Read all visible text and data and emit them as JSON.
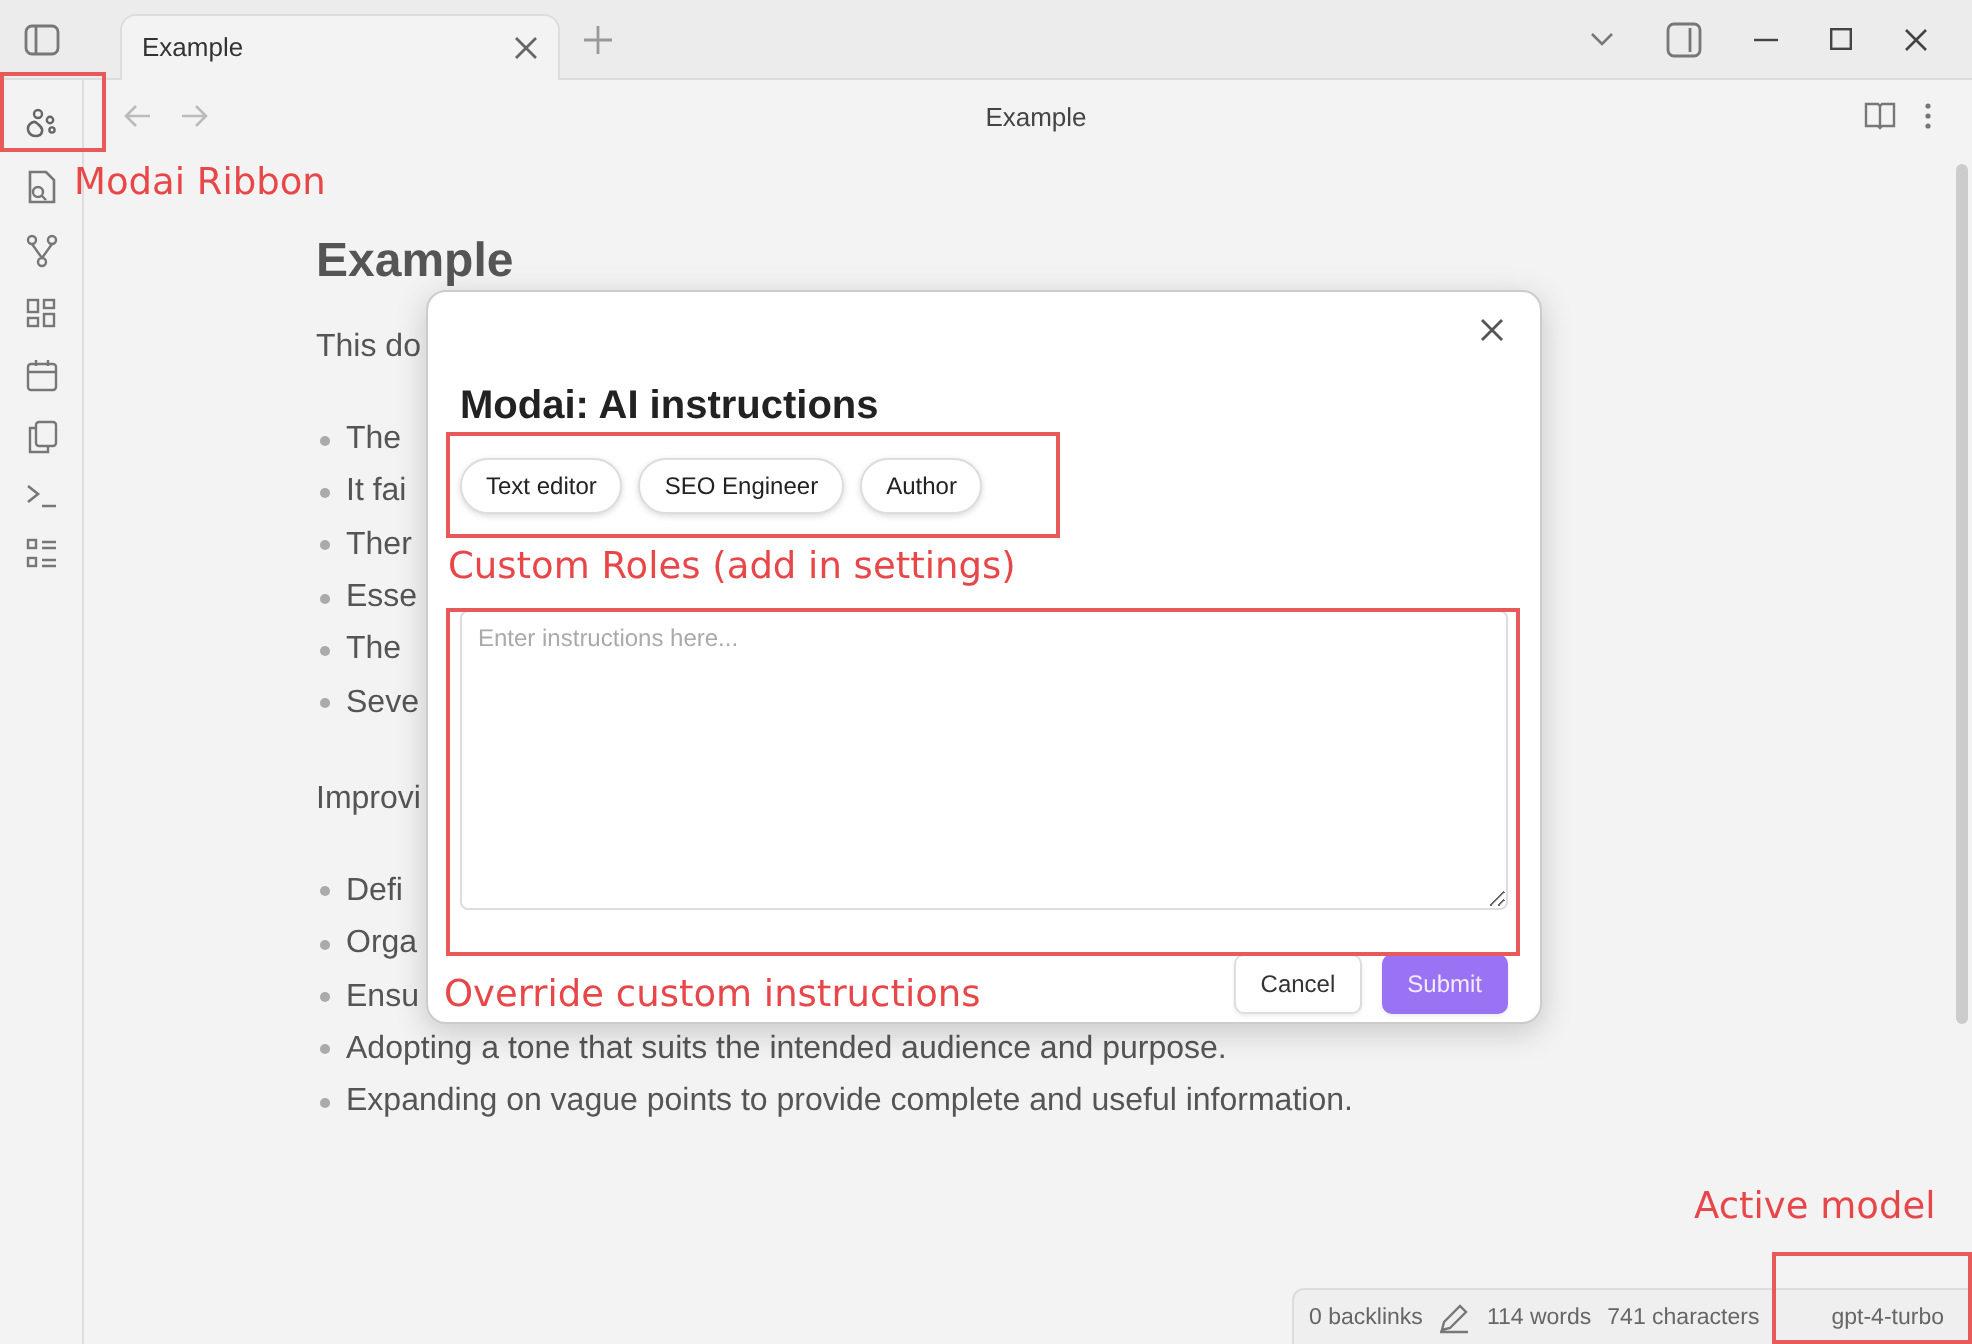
{
  "tabs": [
    {
      "label": "Example",
      "selected": true
    }
  ],
  "nav": {
    "title": "Example"
  },
  "document": {
    "heading": "Example",
    "intro": "This do",
    "bullets_1": [
      "The",
      "It fai",
      "Ther",
      "Esse",
      "The",
      "Seve"
    ],
    "paragraph": "Improvi",
    "bullets_2": [
      "Defi",
      "Orga",
      "Ensu",
      "Adopting a tone that suits the intended audience and purpose.",
      "Expanding on vague points to provide complete and useful information."
    ]
  },
  "modal": {
    "title": "Modai: AI instructions",
    "roles": [
      "Text editor",
      "SEO Engineer",
      "Author"
    ],
    "instructions": {
      "placeholder": "Enter instructions here..."
    },
    "buttons": [
      {
        "label": "Cancel",
        "kind": "secondary"
      },
      {
        "label": "Submit",
        "kind": "primary"
      }
    ]
  },
  "status_bar": {
    "backlinks": "0 backlinks",
    "words": "114 words",
    "characters": "741 characters",
    "model": "gpt-4-turbo"
  },
  "annotations": [
    {
      "text": "Modai Ribbon"
    },
    {
      "text": "Custom Roles (add in settings)"
    },
    {
      "text": "Override custom instructions"
    },
    {
      "text": "Active model"
    }
  ]
}
